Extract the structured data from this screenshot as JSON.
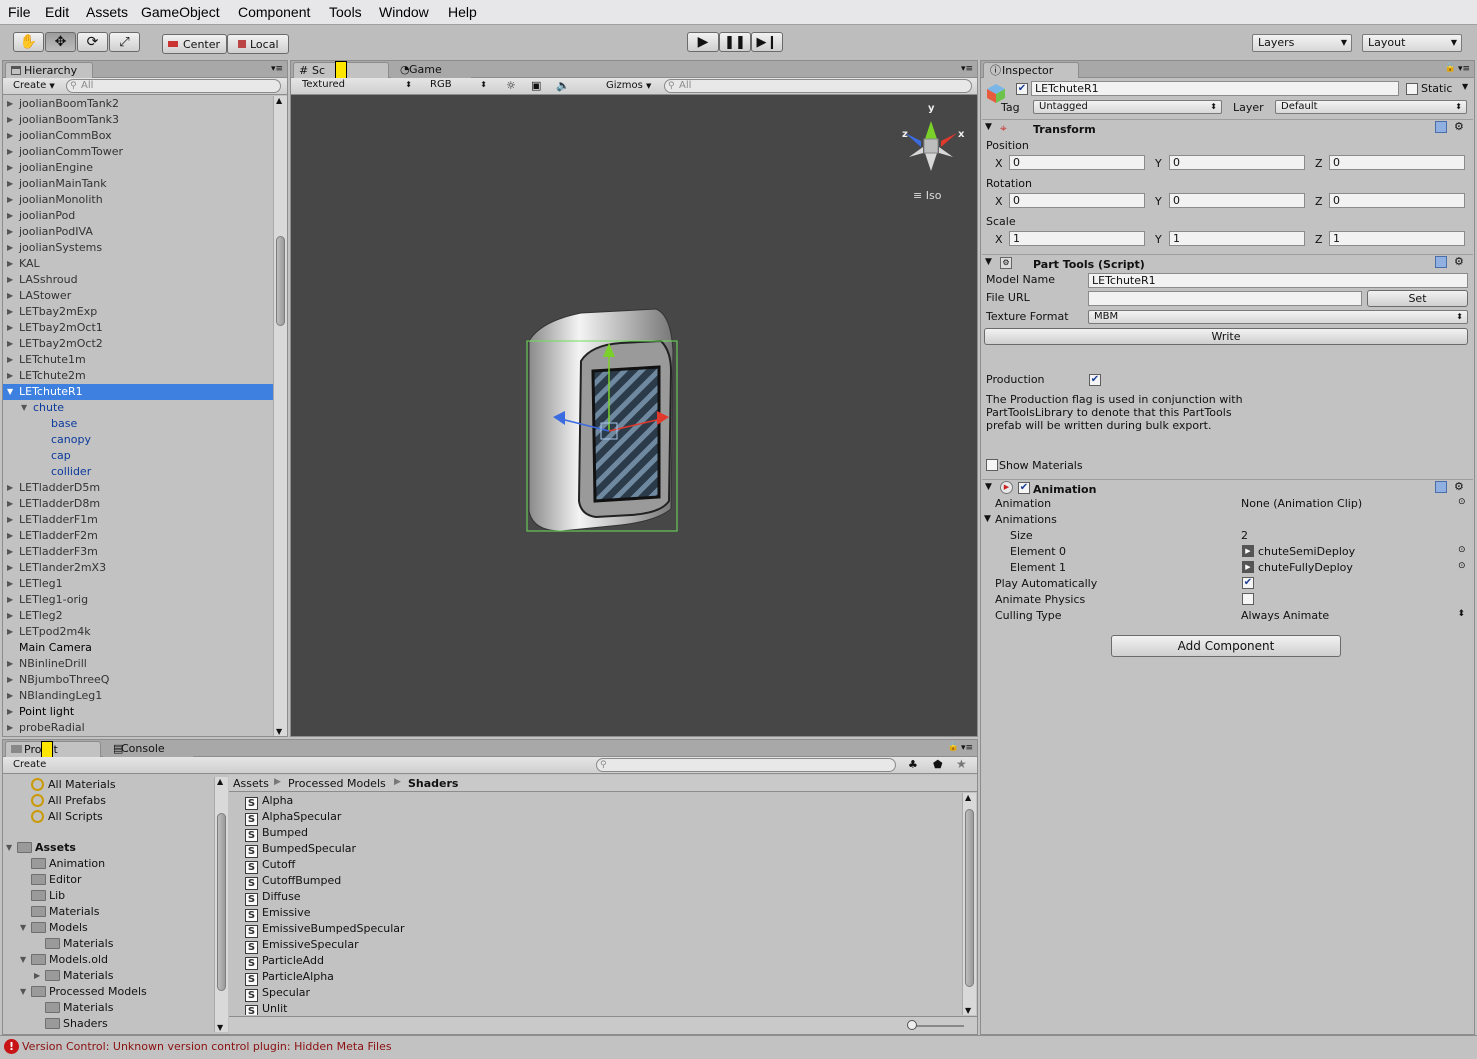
{
  "menu": [
    "File",
    "Edit",
    "Assets",
    "GameObject",
    "Component",
    "Tools",
    "Window",
    "Help"
  ],
  "toolbar": {
    "pivot": "Center",
    "space": "Local",
    "layers": "Layers",
    "layout": "Layout"
  },
  "hierarchy": {
    "tab": "Hierarchy",
    "create": "Create",
    "search_placeholder": "All",
    "items": [
      "joolianBoomTank2",
      "joolianBoomTank3",
      "joolianCommBox",
      "joolianCommTower",
      "joolianEngine",
      "joolianMainTank",
      "joolianMonolith",
      "joolianPod",
      "joolianPodIVA",
      "joolianSystems",
      "KAL",
      "LASshroud",
      "LAStower",
      "LETbay2mExp",
      "LETbay2mOct1",
      "LETbay2mOct2",
      "LETchute1m",
      "LETchute2m",
      "LETchuteR1",
      "chute",
      "base",
      "canopy",
      "cap",
      "collider",
      "LETladderD5m",
      "LETladderD8m",
      "LETladderF1m",
      "LETladderF2m",
      "LETladderF3m",
      "LETlander2mX3",
      "LETleg1",
      "LETleg1-orig",
      "LETleg2",
      "LETpod2m4k",
      "Main Camera",
      "NBinlineDrill",
      "NBjumboThreeQ",
      "NBlandingLeg1",
      "Point light",
      "probeRadial"
    ]
  },
  "scene": {
    "tab_scene": "Sc",
    "tab_game": "Game",
    "render_mode": "Textured",
    "color_mode": "RGB",
    "gizmos": "Gizmos",
    "search_placeholder": "All",
    "gizmo_x": "x",
    "gizmo_y": "y",
    "gizmo_z": "z",
    "projection": "Iso"
  },
  "inspector": {
    "tab": "Inspector",
    "name": "LETchuteR1",
    "static": "Static",
    "tag_label": "Tag",
    "tag": "Untagged",
    "layer_label": "Layer",
    "layer": "Default",
    "transform": {
      "title": "Transform",
      "position": "Position",
      "rotation": "Rotation",
      "scale": "Scale",
      "x": "X",
      "y": "Y",
      "z": "Z",
      "pos": [
        "0",
        "0",
        "0"
      ],
      "rot": [
        "0",
        "0",
        "0"
      ],
      "scl": [
        "1",
        "1",
        "1"
      ]
    },
    "parttools": {
      "title": "Part Tools (Script)",
      "model_name_label": "Model Name",
      "model_name": "LETchuteR1",
      "file_url_label": "File URL",
      "file_url": "",
      "set": "Set",
      "texture_format_label": "Texture Format",
      "texture_format": "MBM",
      "write": "Write",
      "production_label": "Production",
      "description_1": "The Production flag is used in conjunction with",
      "description_2": "PartToolsLibrary to denote that this PartTools",
      "description_3": "prefab will be written during bulk export.",
      "show_materials": "Show Materials"
    },
    "animation": {
      "title": "Animation",
      "animation_label": "Animation",
      "animation_value": "None (Animation Clip)",
      "animations_label": "Animations",
      "size_label": "Size",
      "size": "2",
      "el0_label": "Element 0",
      "el0": "chuteSemiDeploy",
      "el1_label": "Element 1",
      "el1": "chuteFullyDeploy",
      "play_auto": "Play Automatically",
      "animate_physics": "Animate Physics",
      "culling_label": "Culling Type",
      "culling": "Always Animate"
    },
    "add_component": "Add Component"
  },
  "project": {
    "tab_project": "Pro",
    "tab_project_end": "t",
    "tab_console": "Console",
    "create": "Create",
    "favorites": [
      "All Materials",
      "All Prefabs",
      "All Scripts"
    ],
    "tree": [
      {
        "label": "Assets",
        "level": 0,
        "bold": true
      },
      {
        "label": "Animation",
        "level": 1
      },
      {
        "label": "Editor",
        "level": 1
      },
      {
        "label": "Lib",
        "level": 1
      },
      {
        "label": "Materials",
        "level": 1
      },
      {
        "label": "Models",
        "level": 1
      },
      {
        "label": "Materials",
        "level": 2
      },
      {
        "label": "Models.old",
        "level": 1
      },
      {
        "label": "Materials",
        "level": 2
      },
      {
        "label": "Processed Models",
        "level": 1
      },
      {
        "label": "Materials",
        "level": 2
      },
      {
        "label": "Shaders",
        "level": 2
      }
    ],
    "breadcrumb": [
      "Assets",
      "Processed Models",
      "Shaders"
    ],
    "files": [
      "Alpha",
      "AlphaSpecular",
      "Bumped",
      "BumpedSpecular",
      "Cutoff",
      "CutoffBumped",
      "Diffuse",
      "Emissive",
      "EmissiveBumpedSpecular",
      "EmissiveSpecular",
      "ParticleAdd",
      "ParticleAlpha",
      "Specular",
      "Unlit"
    ]
  },
  "status": "Version Control: Unknown version control plugin: Hidden Meta Files"
}
